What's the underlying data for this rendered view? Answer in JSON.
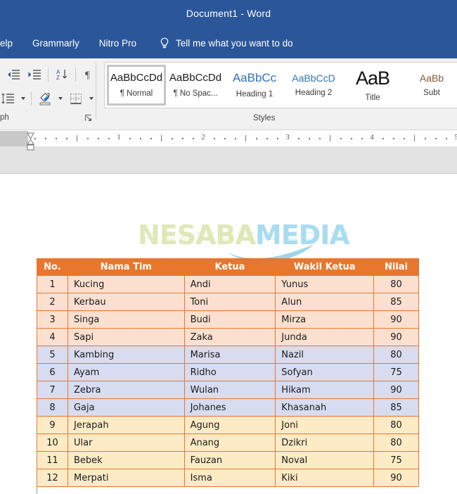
{
  "window": {
    "title": "Document1  -  Word",
    "accent_color": "#2b579a"
  },
  "ribbon": {
    "tabs": [
      {
        "label": "elp",
        "name": "tab-help"
      },
      {
        "label": "Grammarly",
        "name": "tab-grammarly"
      },
      {
        "label": "Nitro Pro",
        "name": "tab-nitro-pro"
      }
    ],
    "tellme": {
      "icon": "lightbulb-icon",
      "placeholder": "Tell me what you want to do"
    },
    "paragraph_group": {
      "label": "ph",
      "buttons": [
        {
          "name": "decrease-indent-button",
          "icon": "decrease-indent-icon"
        },
        {
          "name": "increase-indent-button",
          "icon": "increase-indent-icon"
        },
        {
          "name": "sort-button",
          "icon": "sort-az-icon"
        },
        {
          "name": "show-formatting-marks-button",
          "icon": "pilcrow-icon"
        },
        {
          "name": "line-spacing-button",
          "icon": "line-spacing-icon"
        },
        {
          "name": "shading-button",
          "icon": "shading-paint-icon"
        },
        {
          "name": "borders-button",
          "icon": "borders-icon"
        }
      ],
      "dialog_launcher": "paragraph-dialog-launcher"
    },
    "styles_group": {
      "label": "Styles",
      "items": [
        {
          "preview": "AaBbCcDd",
          "name": "¶ Normal",
          "selected": true
        },
        {
          "preview": "AaBbCcDd",
          "name": "¶ No Spac...",
          "selected": false
        },
        {
          "preview": "AaBbCс",
          "name": "Heading 1",
          "selected": false
        },
        {
          "preview": "AaBbCcD",
          "name": "Heading 2",
          "selected": false
        },
        {
          "preview": "AaB",
          "name": "Title",
          "selected": false
        },
        {
          "preview": "AaBb",
          "name": "Subt",
          "selected": false
        }
      ]
    }
  },
  "ruler": {
    "marks": [
      "1",
      "2",
      "3",
      "4",
      "5"
    ]
  },
  "document": {
    "watermark": {
      "part1": "NESABA",
      "part2": "MEDIA"
    },
    "table": {
      "headers": [
        "No.",
        "Nama Tim",
        "Ketua",
        "Wakil Ketua",
        "Nilai"
      ],
      "header_bg": "#e8762d",
      "group_colors": {
        "peach": "#fbe0d0",
        "blue": "#d7dcf0",
        "yellow": "#fcebc5"
      },
      "rows": [
        {
          "no": "1",
          "tim": "Kucing",
          "ketua": "Andi",
          "wakil": "Yunus",
          "nilai": "80",
          "group": "peach"
        },
        {
          "no": "2",
          "tim": "Kerbau",
          "ketua": "Toni",
          "wakil": "Alun",
          "nilai": "85",
          "group": "peach"
        },
        {
          "no": "3",
          "tim": "Singa",
          "ketua": "Budi",
          "wakil": "Mirza",
          "nilai": "90",
          "group": "peach"
        },
        {
          "no": "4",
          "tim": "Sapi",
          "ketua": "Zaka",
          "wakil": "Junda",
          "nilai": "90",
          "group": "peach"
        },
        {
          "no": "5",
          "tim": "Kambing",
          "ketua": "Marisa",
          "wakil": "Nazil",
          "nilai": "80",
          "group": "blue"
        },
        {
          "no": "6",
          "tim": "Ayam",
          "ketua": "Ridho",
          "wakil": "Sofyan",
          "nilai": "75",
          "group": "blue"
        },
        {
          "no": "7",
          "tim": "Zebra",
          "ketua": "Wulan",
          "wakil": "Hikam",
          "nilai": "90",
          "group": "blue"
        },
        {
          "no": "8",
          "tim": "Gaja",
          "ketua": "Johanes",
          "wakil": "Khasanah",
          "nilai": "85",
          "group": "blue"
        },
        {
          "no": "9",
          "tim": "Jerapah",
          "ketua": "Agung",
          "wakil": "Joni",
          "nilai": "80",
          "group": "yellow"
        },
        {
          "no": "10",
          "tim": "Ular",
          "ketua": "Anang",
          "wakil": "Dzikri",
          "nilai": "80",
          "group": "yellow"
        },
        {
          "no": "11",
          "tim": "Bebek",
          "ketua": "Fauzan",
          "wakil": "Noval",
          "nilai": "75",
          "group": "yellow"
        },
        {
          "no": "12",
          "tim": "Merpati",
          "ketua": "Isma",
          "wakil": "Kiki",
          "nilai": "90",
          "group": "yellow"
        }
      ]
    }
  }
}
